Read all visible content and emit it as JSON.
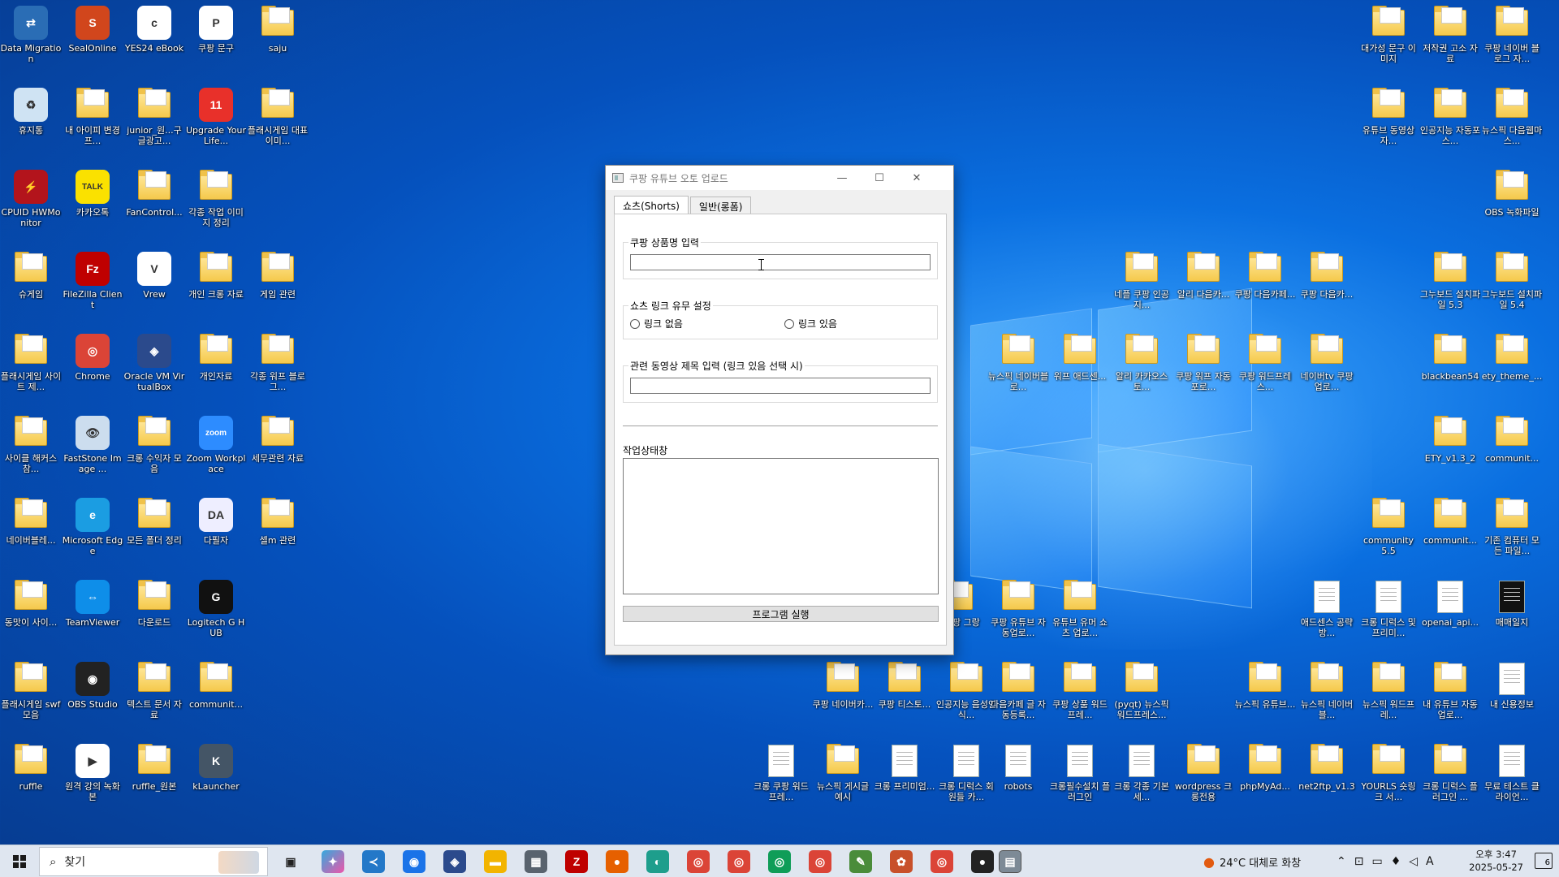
{
  "desktop": {
    "left_icons": [
      {
        "label": "Data Migration",
        "icon": "data-migration-icon"
      },
      {
        "label": "SealOnline",
        "icon": "sealonline-icon"
      },
      {
        "label": "YES24 eBook",
        "icon": "crema-ebook-icon"
      },
      {
        "label": "쿠팡 문구",
        "icon": "pptx-icon"
      },
      {
        "label": "saju",
        "icon": "folder-icon"
      },
      {
        "label": "휴지통",
        "icon": "recycle-bin-icon"
      },
      {
        "label": "내 아이피 변경 프...",
        "icon": "folder-icon"
      },
      {
        "label": "junior_원...구글광고...",
        "icon": "folder-icon"
      },
      {
        "label": "Upgrade Your Life...",
        "icon": "upgrade-app-icon"
      },
      {
        "label": "플래시게임 대표이미...",
        "icon": "folder-icon"
      },
      {
        "label": "CPUID HWMonitor",
        "icon": "hwmonitor-icon"
      },
      {
        "label": "카카오톡",
        "icon": "kakaotalk-icon"
      },
      {
        "label": "FanControl...",
        "icon": "folder-icon"
      },
      {
        "label": "각종 작업 이미지 정리",
        "icon": "folder-icon"
      },
      {
        "label": "슈게임",
        "icon": "folder-icon"
      },
      {
        "label": "FileZilla Client",
        "icon": "filezilla-icon"
      },
      {
        "label": "Vrew",
        "icon": "vrew-icon"
      },
      {
        "label": "개인 크롱 자료",
        "icon": "folder-icon"
      },
      {
        "label": "게임 관련",
        "icon": "folder-icon"
      },
      {
        "label": "플래시게임 사이트 제...",
        "icon": "folder-icon"
      },
      {
        "label": "Chrome",
        "icon": "chrome-icon"
      },
      {
        "label": "Oracle VM VirtualBox",
        "icon": "virtualbox-icon"
      },
      {
        "label": "개인자료",
        "icon": "folder-icon"
      },
      {
        "label": "각종 워프 블로그...",
        "icon": "folder-icon"
      },
      {
        "label": "사이클 해커스 참...",
        "icon": "folder-icon"
      },
      {
        "label": "FastStone Image ...",
        "icon": "faststone-icon"
      },
      {
        "label": "크롱 수익자 모음",
        "icon": "folder-icon"
      },
      {
        "label": "Zoom Workplace",
        "icon": "zoom-icon"
      },
      {
        "label": "세무관련 자료",
        "icon": "folder-icon"
      },
      {
        "label": "네이버블레...",
        "icon": "folder-icon"
      },
      {
        "label": "Microsoft Edge",
        "icon": "edge-icon"
      },
      {
        "label": "모든 폴더 정리",
        "icon": "folder-icon"
      },
      {
        "label": "다필자",
        "icon": "dabilja-icon"
      },
      {
        "label": "셀m 관련",
        "icon": "folder-icon"
      },
      {
        "label": "동맛이 사이...",
        "icon": "folder-icon"
      },
      {
        "label": "TeamViewer",
        "icon": "teamviewer-icon"
      },
      {
        "label": "다운로드",
        "icon": "folder-icon"
      },
      {
        "label": "Logitech G HUB",
        "icon": "logitech-icon"
      },
      {
        "label": "플래시게임 swf 모음",
        "icon": "folder-icon"
      },
      {
        "label": "OBS Studio",
        "icon": "obs-icon"
      },
      {
        "label": "텍스트 문서 자료",
        "icon": "folder-icon"
      },
      {
        "label": "communit...",
        "icon": "folder-icon"
      },
      {
        "label": "ruffle",
        "icon": "folder-icon"
      },
      {
        "label": "원격 강의 녹화본",
        "icon": "remote-icon"
      },
      {
        "label": "ruffle_원본",
        "icon": "folder-icon"
      },
      {
        "label": "kLauncher",
        "icon": "klauncher-icon"
      }
    ],
    "right_icons": [
      {
        "label": "대가성 문구 이미지",
        "icon": "folder-icon"
      },
      {
        "label": "저작권 고소 자료",
        "icon": "folder-icon"
      },
      {
        "label": "쿠팡 네이버 블로그 자...",
        "icon": "folder-icon"
      },
      {
        "label": "유튜브 동영상 자...",
        "icon": "folder-icon"
      },
      {
        "label": "인공지능 자동포스...",
        "icon": "folder-icon"
      },
      {
        "label": "뉴스픽 다음웹마스...",
        "icon": "folder-icon"
      },
      {
        "label": "OBS 녹화파일",
        "icon": "folder-icon"
      },
      {
        "label": "네플 쿠팡 인공지...",
        "icon": "folder-icon"
      },
      {
        "label": "알리 다음카...",
        "icon": "folder-icon"
      },
      {
        "label": "쿠팡 다음카페...",
        "icon": "folder-icon"
      },
      {
        "label": "쿠팡 다음카...",
        "icon": "folder-icon"
      },
      {
        "label": "그누보드 설치파일 5.3",
        "icon": "folder-icon"
      },
      {
        "label": "그누보드 설치파일 5.4",
        "icon": "folder-icon"
      },
      {
        "label": "뉴스픽 네이버블로...",
        "icon": "folder-icon"
      },
      {
        "label": "워프 애드센...",
        "icon": "folder-icon"
      },
      {
        "label": "알리 카카오스토...",
        "icon": "folder-icon"
      },
      {
        "label": "쿠팡 워프 자동 포로...",
        "icon": "folder-icon"
      },
      {
        "label": "쿠팡 워드프레스...",
        "icon": "folder-icon"
      },
      {
        "label": "네이버tv 쿠팡 업로...",
        "icon": "folder-icon"
      },
      {
        "label": "blackbean54",
        "icon": "folder-icon"
      },
      {
        "label": "ety_theme_...",
        "icon": "folder-icon"
      },
      {
        "label": "ETY_v1.3_2",
        "icon": "folder-icon"
      },
      {
        "label": "communit...",
        "icon": "folder-icon"
      },
      {
        "label": "community 5.5",
        "icon": "folder-icon"
      },
      {
        "label": "communit...",
        "icon": "folder-icon"
      },
      {
        "label": "기존 컴퓨터 모든 파일...",
        "icon": "folder-icon"
      },
      {
        "label": "애드센스 공략 방...",
        "icon": "shortcut-doc-icon"
      },
      {
        "label": "크롱 디럭스 및 프리미...",
        "icon": "shortcut-doc-icon"
      },
      {
        "label": "openai_api...",
        "icon": "document-icon"
      },
      {
        "label": "매매일지",
        "icon": "black-file-icon"
      },
      {
        "label": "네 쿠팡 그랑",
        "icon": "folder-icon"
      },
      {
        "label": "쿠팡 유튜브 자동업로...",
        "icon": "folder-icon"
      },
      {
        "label": "유튜브 유머 쇼츠 업로...",
        "icon": "folder-icon"
      },
      {
        "label": "쿠팡 네이버카...",
        "icon": "folder-icon"
      },
      {
        "label": "쿠팡 티스토...",
        "icon": "folder-icon"
      },
      {
        "label": "인공지능 음성인식...",
        "icon": "folder-icon"
      },
      {
        "label": "다음카페 글 자동등록...",
        "icon": "folder-icon"
      },
      {
        "label": "쿠팡 상품 워드프레...",
        "icon": "folder-icon"
      },
      {
        "label": "(pyqt) 뉴스픽 워드프레스...",
        "icon": "folder-icon"
      },
      {
        "label": "뉴스픽 유튜브...",
        "icon": "folder-icon"
      },
      {
        "label": "뉴스픽 네이버블...",
        "icon": "folder-icon"
      },
      {
        "label": "뉴스픽 워드프레...",
        "icon": "folder-icon"
      },
      {
        "label": "내 유튜브 자동업로...",
        "icon": "folder-icon"
      },
      {
        "label": "내 신용정보",
        "icon": "document-icon"
      },
      {
        "label": "크롱 쿠팡 워드프레...",
        "icon": "document-icon"
      },
      {
        "label": "뉴스픽 게시글 예시",
        "icon": "folder-icon"
      },
      {
        "label": "크롱 프리미엄...",
        "icon": "document-icon"
      },
      {
        "label": "크롱 디럭스 회원들 카...",
        "icon": "document-icon"
      },
      {
        "label": "robots",
        "icon": "document-icon"
      },
      {
        "label": "크롱필수설치 플러그인",
        "icon": "document-icon"
      },
      {
        "label": "크롱 각종 기본 세...",
        "icon": "document-icon"
      },
      {
        "label": "wordpress 크롱전용",
        "icon": "folder-icon"
      },
      {
        "label": "phpMyAd...",
        "icon": "folder-icon"
      },
      {
        "label": "net2ftp_v1.3",
        "icon": "folder-icon"
      },
      {
        "label": "YOURLS 숏링크 서...",
        "icon": "folder-icon"
      },
      {
        "label": "크롱 디럭스 플러그인 ...",
        "icon": "folder-icon"
      },
      {
        "label": "무료 테스트 클라이언...",
        "icon": "document-icon"
      }
    ]
  },
  "window": {
    "title": "쿠팡 유튜브 오토 업로드",
    "minimize": "—",
    "maximize": "☐",
    "close": "✕",
    "tabs": [
      {
        "label": "쇼츠(Shorts)",
        "active": true
      },
      {
        "label": "일반(롱폼)",
        "active": false
      }
    ],
    "product_group_title": "쿠팡 상품명 입력",
    "product_input_value": "",
    "link_group_title": "쇼츠 링크 유무 설정",
    "radio_no_link": "링크 없음",
    "radio_with_link": "링크 있음",
    "related_group_title": "관련 동영상 제목 입력 (링크 있음 선택 시)",
    "related_input_value": "",
    "status_label": "작업상태창",
    "status_text": "",
    "run_button": "프로그램 실행"
  },
  "taskbar": {
    "search_placeholder": "찾기",
    "weather": "24°C  대체로 화창",
    "ime": "A",
    "time_line1": "오후 3:47",
    "time_line2": "2025-05-27",
    "notification_count": "6"
  }
}
